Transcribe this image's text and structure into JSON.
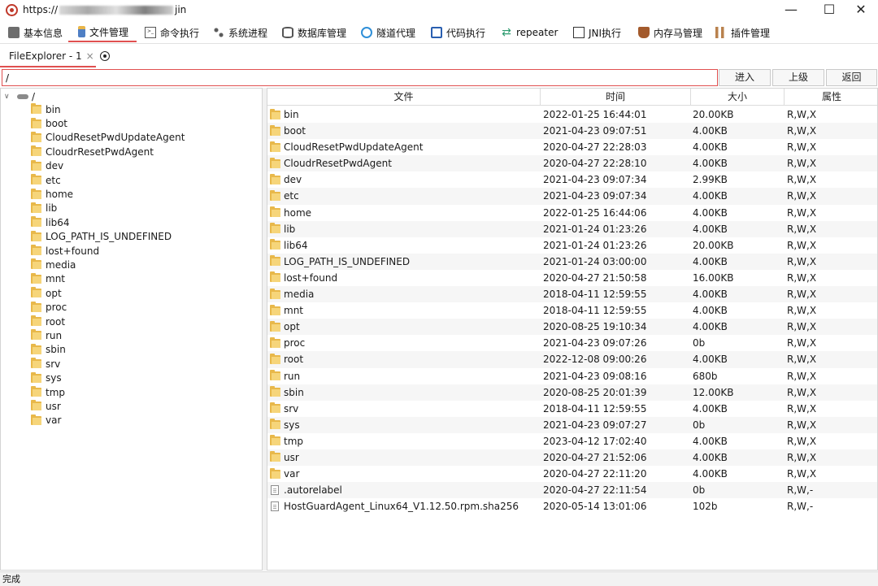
{
  "window": {
    "title_prefix": "https://",
    "title_suffix": "jin",
    "minimize_glyph": "—",
    "maximize_glyph": "☐",
    "close_glyph": "✕"
  },
  "toolbar": {
    "tabs": [
      {
        "label": "基本信息",
        "icon": "info-icon"
      },
      {
        "label": "文件管理",
        "icon": "file-manager-icon",
        "active": true
      },
      {
        "label": "命令执行",
        "icon": "terminal-icon"
      },
      {
        "label": "系统进程",
        "icon": "process-icon"
      },
      {
        "label": "数据库管理",
        "icon": "database-icon"
      },
      {
        "label": "隧道代理",
        "icon": "tunnel-icon"
      },
      {
        "label": "代码执行",
        "icon": "code-icon"
      },
      {
        "label": "repeater",
        "icon": "repeater-icon"
      },
      {
        "label": "JNI执行",
        "icon": "jni-icon"
      },
      {
        "label": "内存马管理",
        "icon": "memshell-icon"
      },
      {
        "label": "插件管理",
        "icon": "plugin-icon"
      }
    ]
  },
  "subtab": {
    "label": "FileExplorer - 1",
    "close": "×"
  },
  "pathbar": {
    "path_value": "/",
    "enter_label": "进入",
    "up_label": "上级",
    "back_label": "返回"
  },
  "tree": {
    "root_label": "/",
    "items": [
      "bin",
      "boot",
      "CloudResetPwdUpdateAgent",
      "CloudrResetPwdAgent",
      "dev",
      "etc",
      "home",
      "lib",
      "lib64",
      "LOG_PATH_IS_UNDEFINED",
      "lost+found",
      "media",
      "mnt",
      "opt",
      "proc",
      "root",
      "run",
      "sbin",
      "srv",
      "sys",
      "tmp",
      "usr",
      "var"
    ]
  },
  "table": {
    "headers": {
      "name": "文件",
      "time": "时间",
      "size": "大小",
      "attr": "属性"
    },
    "rows": [
      {
        "name": "bin",
        "type": "folder",
        "time": "2022-01-25 16:44:01",
        "size": "20.00KB",
        "attr": "R,W,X"
      },
      {
        "name": "boot",
        "type": "folder",
        "time": "2021-04-23 09:07:51",
        "size": "4.00KB",
        "attr": "R,W,X"
      },
      {
        "name": "CloudResetPwdUpdateAgent",
        "type": "folder",
        "time": "2020-04-27 22:28:03",
        "size": "4.00KB",
        "attr": "R,W,X"
      },
      {
        "name": "CloudrResetPwdAgent",
        "type": "folder",
        "time": "2020-04-27 22:28:10",
        "size": "4.00KB",
        "attr": "R,W,X"
      },
      {
        "name": "dev",
        "type": "folder",
        "time": "2021-04-23 09:07:34",
        "size": "2.99KB",
        "attr": "R,W,X"
      },
      {
        "name": "etc",
        "type": "folder",
        "time": "2021-04-23 09:07:34",
        "size": "4.00KB",
        "attr": "R,W,X"
      },
      {
        "name": "home",
        "type": "folder",
        "time": "2022-01-25 16:44:06",
        "size": "4.00KB",
        "attr": "R,W,X"
      },
      {
        "name": "lib",
        "type": "folder",
        "time": "2021-01-24 01:23:26",
        "size": "4.00KB",
        "attr": "R,W,X"
      },
      {
        "name": "lib64",
        "type": "folder",
        "time": "2021-01-24 01:23:26",
        "size": "20.00KB",
        "attr": "R,W,X"
      },
      {
        "name": "LOG_PATH_IS_UNDEFINED",
        "type": "folder",
        "time": "2021-01-24 03:00:00",
        "size": "4.00KB",
        "attr": "R,W,X"
      },
      {
        "name": "lost+found",
        "type": "folder",
        "time": "2020-04-27 21:50:58",
        "size": "16.00KB",
        "attr": "R,W,X"
      },
      {
        "name": "media",
        "type": "folder",
        "time": "2018-04-11 12:59:55",
        "size": "4.00KB",
        "attr": "R,W,X"
      },
      {
        "name": "mnt",
        "type": "folder",
        "time": "2018-04-11 12:59:55",
        "size": "4.00KB",
        "attr": "R,W,X"
      },
      {
        "name": "opt",
        "type": "folder",
        "time": "2020-08-25 19:10:34",
        "size": "4.00KB",
        "attr": "R,W,X"
      },
      {
        "name": "proc",
        "type": "folder",
        "time": "2021-04-23 09:07:26",
        "size": "0b",
        "attr": "R,W,X"
      },
      {
        "name": "root",
        "type": "folder",
        "time": "2022-12-08 09:00:26",
        "size": "4.00KB",
        "attr": "R,W,X"
      },
      {
        "name": "run",
        "type": "folder",
        "time": "2021-04-23 09:08:16",
        "size": "680b",
        "attr": "R,W,X"
      },
      {
        "name": "sbin",
        "type": "folder",
        "time": "2020-08-25 20:01:39",
        "size": "12.00KB",
        "attr": "R,W,X"
      },
      {
        "name": "srv",
        "type": "folder",
        "time": "2018-04-11 12:59:55",
        "size": "4.00KB",
        "attr": "R,W,X"
      },
      {
        "name": "sys",
        "type": "folder",
        "time": "2021-04-23 09:07:27",
        "size": "0b",
        "attr": "R,W,X"
      },
      {
        "name": "tmp",
        "type": "folder",
        "time": "2023-04-12 17:02:40",
        "size": "4.00KB",
        "attr": "R,W,X"
      },
      {
        "name": "usr",
        "type": "folder",
        "time": "2020-04-27 21:52:06",
        "size": "4.00KB",
        "attr": "R,W,X"
      },
      {
        "name": "var",
        "type": "folder",
        "time": "2020-04-27 22:11:20",
        "size": "4.00KB",
        "attr": "R,W,X"
      },
      {
        "name": ".autorelabel",
        "type": "file",
        "time": "2020-04-27 22:11:54",
        "size": "0b",
        "attr": "R,W,-"
      },
      {
        "name": "HostGuardAgent_Linux64_V1.12.50.rpm.sha256",
        "type": "file",
        "time": "2020-05-14 13:01:06",
        "size": "102b",
        "attr": "R,W,-"
      }
    ]
  },
  "status": {
    "text": "完成"
  }
}
